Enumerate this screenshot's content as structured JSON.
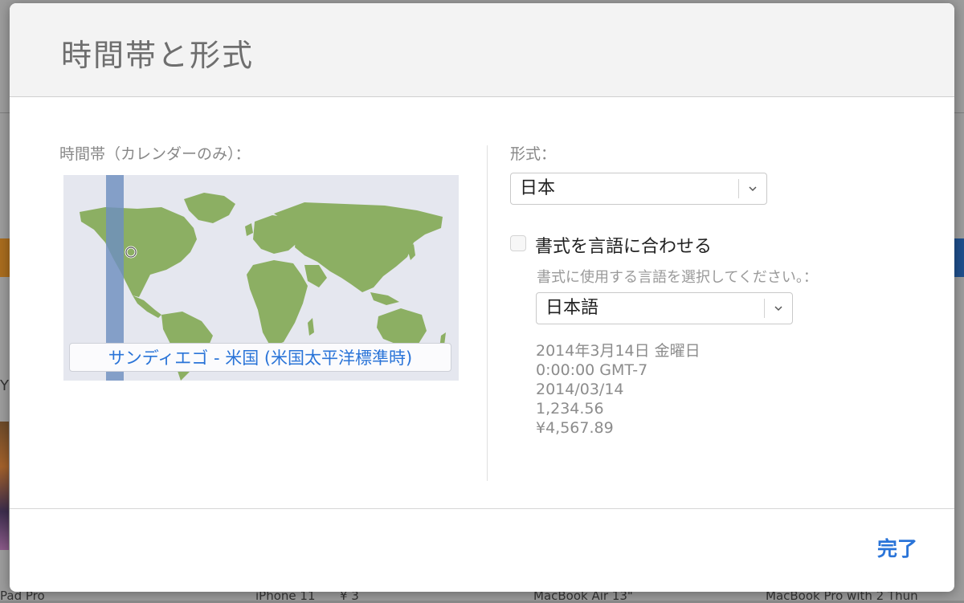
{
  "background": {
    "letter": "Y",
    "products": [
      "Pad Pro",
      "iPhone 11",
      "MacBook Air 13\"",
      "MacBook Pro with 2 Thun"
    ],
    "price_fragment": "¥ 3"
  },
  "dialog": {
    "title": "時間帯と形式",
    "timezone": {
      "label": "時間帯（カレンダーのみ）：",
      "selected": "サンディエゴ - 米国 (米国太平洋標準時)"
    },
    "format": {
      "label": "形式：",
      "region_select": {
        "value": "日本"
      },
      "match_language_checkbox": {
        "label": "書式を言語に合わせる",
        "checked": false
      },
      "language_prompt": "書式に使用する言語を選択してください。：",
      "language_select": {
        "value": "日本語"
      },
      "examples": [
        "2014年3月14日 金曜日",
        "0:00:00 GMT-7",
        "2014/03/14",
        "1,234.56",
        "¥4,567.89"
      ]
    },
    "done_label": "完了"
  },
  "colors": {
    "accent": "#2a74d8",
    "land": "#8caf63",
    "ocean": "#e5e7ef",
    "timezone_band": "#6e8fbf"
  },
  "icons": {
    "select_chevron": "chevron-down-icon",
    "map_marker": "location-marker-icon"
  }
}
